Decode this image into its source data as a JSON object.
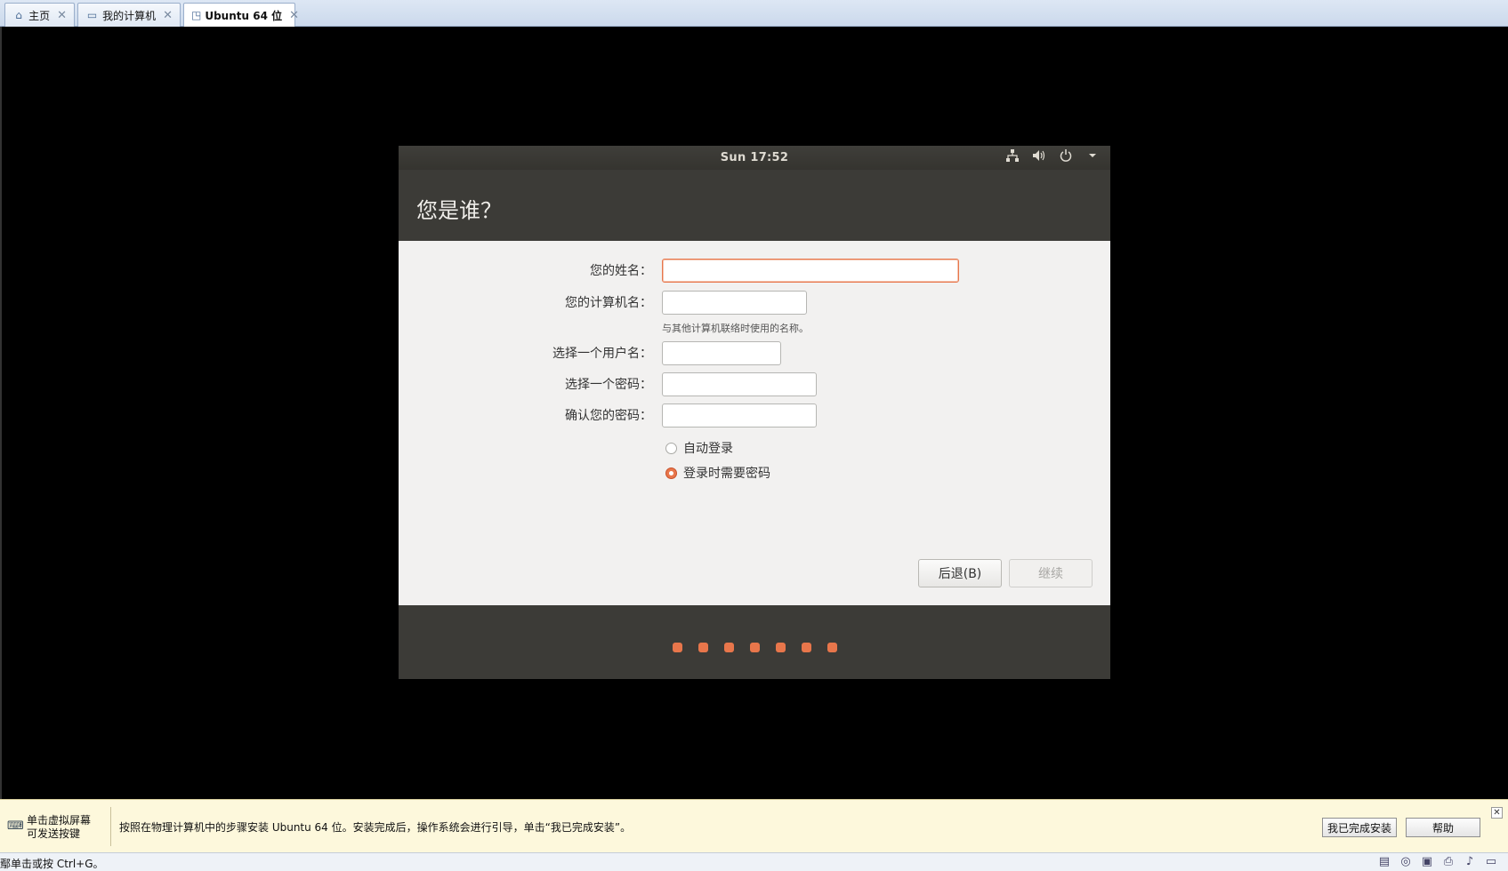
{
  "tabs": [
    {
      "label": "主页",
      "icon": "home-icon"
    },
    {
      "label": "我的计算机",
      "icon": "computer-icon"
    },
    {
      "label": "Ubuntu 64 位",
      "icon": "vm-icon"
    }
  ],
  "topbar": {
    "clock": "Sun 17:52"
  },
  "header": {
    "title": "您是谁？"
  },
  "form": {
    "name_label": "您的姓名：",
    "name_value": "",
    "computer_label": "您的计算机名：",
    "computer_value": "",
    "computer_hint": "与其他计算机联络时使用的名称。",
    "username_label": "选择一个用户名：",
    "username_value": "",
    "password_label": "选择一个密码：",
    "password_value": "",
    "confirm_label": "确认您的密码：",
    "confirm_value": "",
    "auto_login": "自动登录",
    "require_password": "登录时需要密码"
  },
  "buttons": {
    "back": "后退(B)",
    "continue": "继续"
  },
  "progress": {
    "steps": 7
  },
  "infobar": {
    "left_line1": "单击虚拟屏幕",
    "left_line2": "可发送按键",
    "message": "按照在物理计算机中的步骤安装 Ubuntu 64 位。安装完成后，操作系统会进行引导，单击“我已完成安装”。",
    "done_button": "我已完成安装",
    "help_button": "帮助"
  },
  "statusbar": {
    "text": "鄢单击或按 Ctrl+G。"
  },
  "colors": {
    "accent": "#e8764b",
    "panel": "#3c3b37"
  }
}
